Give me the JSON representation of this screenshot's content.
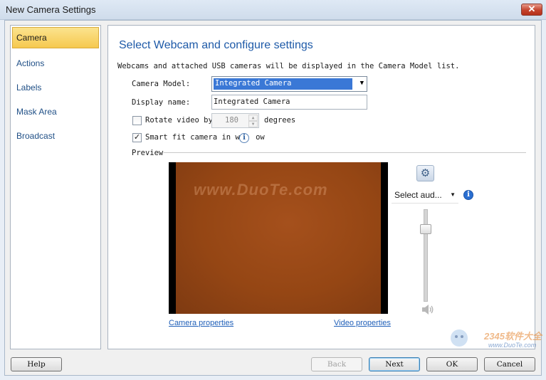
{
  "window": {
    "title": "New Camera Settings",
    "close_label": "✕"
  },
  "sidebar": {
    "items": [
      {
        "label": "Camera",
        "active": true
      },
      {
        "label": "Actions",
        "active": false
      },
      {
        "label": "Labels",
        "active": false
      },
      {
        "label": "Mask Area",
        "active": false
      },
      {
        "label": "Broadcast",
        "active": false
      }
    ]
  },
  "main": {
    "heading": "Select Webcam and configure settings",
    "intro": "Webcams and attached USB cameras will be displayed in the Camera Model list.",
    "camera_model": {
      "label": "Camera Model:",
      "value": "Integrated Camera"
    },
    "display_name": {
      "label": "Display name:",
      "value": "Integrated Camera"
    },
    "rotate": {
      "checked": false,
      "label": "Rotate video by",
      "value": "180",
      "suffix": "degrees"
    },
    "smart_fit": {
      "checked": true,
      "label_a": "Smart fit camera in wi",
      "label_b": "ow"
    },
    "preview_label": "Preview",
    "video_watermark": "www.DuoTe.com",
    "camera_properties_link": "Camera properties",
    "video_properties_link": "Video properties",
    "audio_select": "Select aud...",
    "audio_level": 0.82
  },
  "footer": {
    "help": "Help",
    "back": "Back",
    "next": "Next",
    "ok": "OK",
    "cancel": "Cancel"
  },
  "corner_watermark": {
    "brand": "2345软件大全",
    "url": "www.DuoTe.com"
  },
  "colors": {
    "accent": "#1e5aa8",
    "selection": "#3a78d6",
    "active_tab": "#f6c94f"
  }
}
